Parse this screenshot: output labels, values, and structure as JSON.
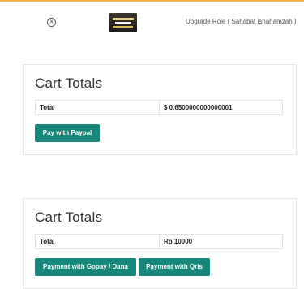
{
  "header": {
    "role_link": "Upgrade Role ( Sahabat isnahamzah )",
    "close_icon": "close-circle-icon",
    "accent_color": "#f2b441"
  },
  "carts": [
    {
      "title": "Cart Totals",
      "total_label": "Total",
      "total_value": "$ 0.6500000000000001",
      "buttons": [
        "Pay with Paypal"
      ]
    },
    {
      "title": "Cart Totals",
      "total_label": "Total",
      "total_value": "Rp 10000",
      "buttons": [
        "Payment with Gopay / Dana",
        "Payment with Qris"
      ]
    }
  ],
  "colors": {
    "button": "#16877a"
  }
}
